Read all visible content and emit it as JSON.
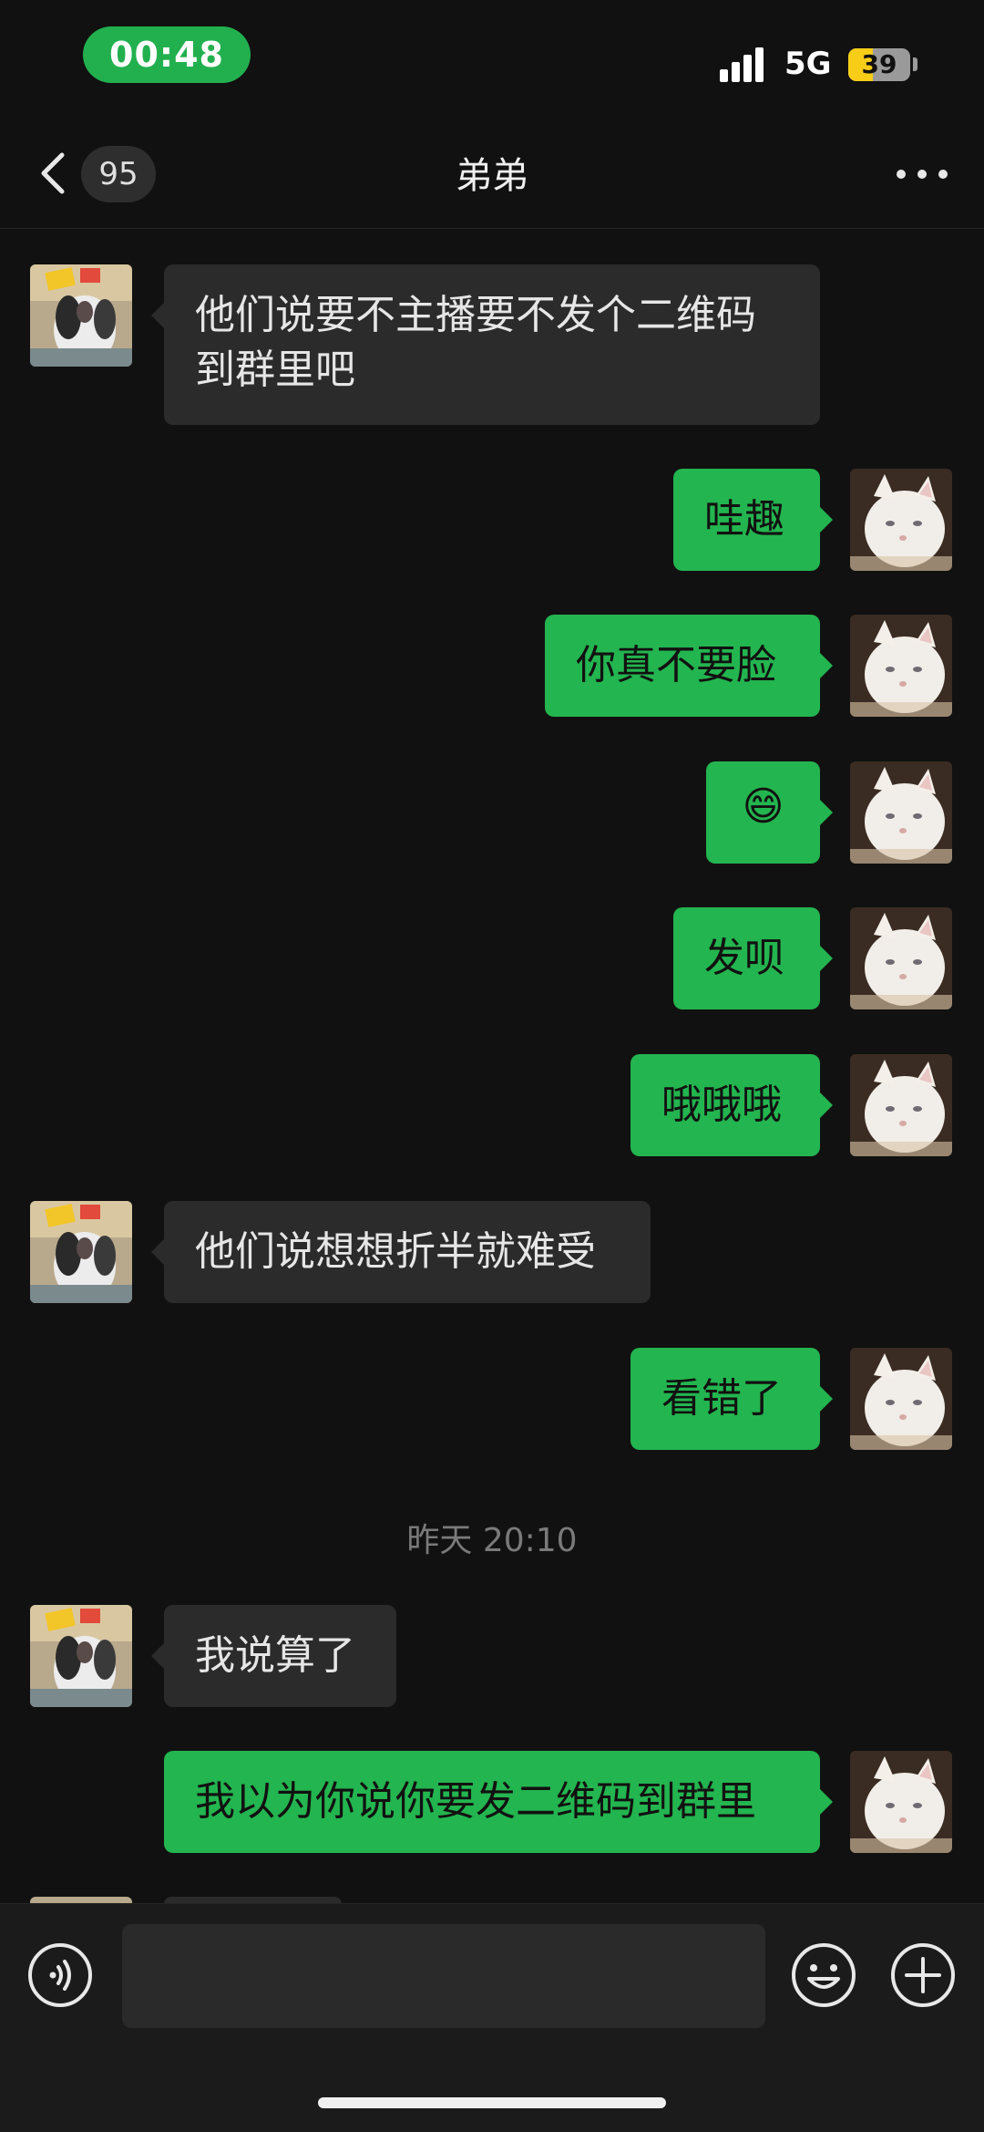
{
  "status_bar": {
    "time": "00:48",
    "network": "5G",
    "battery": "39",
    "battery_level": 0.39
  },
  "nav": {
    "unread_count": "95",
    "title": "弟弟"
  },
  "messages": [
    {
      "side": "in",
      "text_lines": [
        "他们说要不主播要不发个二维码",
        "到群里吧"
      ]
    },
    {
      "side": "out",
      "text": "哇趣"
    },
    {
      "side": "out",
      "text": "你真不要脸"
    },
    {
      "side": "out",
      "text": "😄"
    },
    {
      "side": "out",
      "text": "发呗"
    },
    {
      "side": "out",
      "text": "哦哦哦"
    },
    {
      "side": "in",
      "text": "他们说想想折半就难受"
    },
    {
      "side": "out",
      "text": "看错了"
    },
    {
      "side": "in",
      "text": "我说算了"
    },
    {
      "side": "out",
      "text": "我以为你说你要发二维码到群里"
    }
  ],
  "timestamp": "昨天 20:10",
  "input_bar": {
    "placeholder": ""
  },
  "colors": {
    "outgoing_bubble": "#23b54f",
    "incoming_bubble": "#2b2b2b",
    "time_pill": "#22b04f"
  }
}
